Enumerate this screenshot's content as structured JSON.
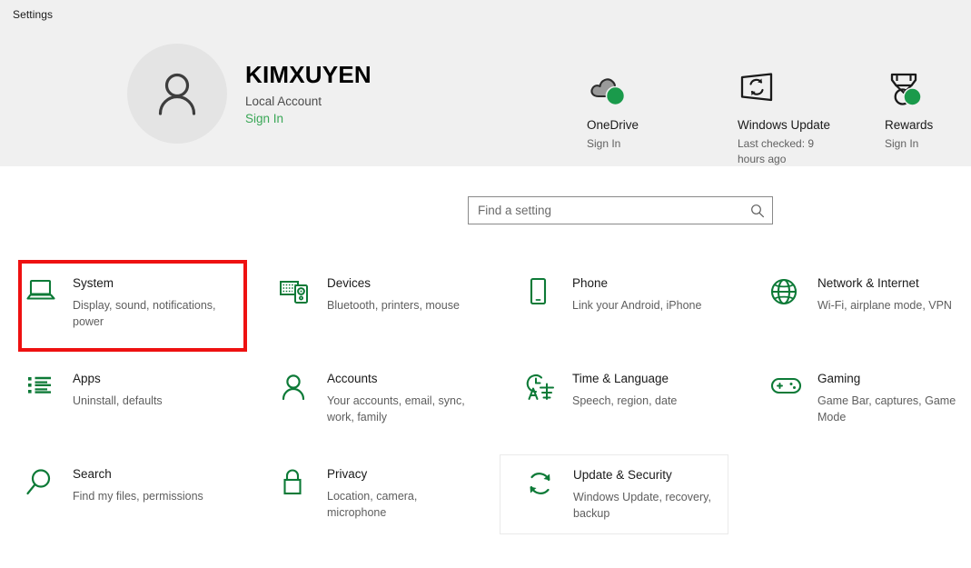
{
  "window": {
    "title": "Settings"
  },
  "account": {
    "name": "KIMXUYEN",
    "type": "Local Account",
    "signin_label": "Sign In",
    "avatar_icon": "person-icon"
  },
  "quick_links": [
    {
      "id": "onedrive",
      "icon": "onedrive-cloud-icon",
      "title": "OneDrive",
      "sub": "Sign In",
      "badge": "online-badge"
    },
    {
      "id": "windows-update",
      "icon": "monitor-sync-icon",
      "title": "Windows Update",
      "sub": "Last checked: 9 hours ago",
      "badge": ""
    },
    {
      "id": "rewards",
      "icon": "medal-icon",
      "title": "Rewards",
      "sub": "Sign In",
      "badge": "online-badge"
    }
  ],
  "search": {
    "placeholder": "Find a setting",
    "value": "",
    "icon": "search-icon"
  },
  "tiles": [
    {
      "id": "system",
      "icon": "laptop-icon",
      "title": "System",
      "sub": "Display, sound, notifications, power"
    },
    {
      "id": "devices",
      "icon": "keyboard-icon",
      "title": "Devices",
      "sub": "Bluetooth, printers, mouse"
    },
    {
      "id": "phone",
      "icon": "phone-icon",
      "title": "Phone",
      "sub": "Link your Android, iPhone"
    },
    {
      "id": "network",
      "icon": "globe-icon",
      "title": "Network & Internet",
      "sub": "Wi-Fi, airplane mode, VPN"
    },
    {
      "id": "apps",
      "icon": "list-icon",
      "title": "Apps",
      "sub": "Uninstall, defaults"
    },
    {
      "id": "accounts",
      "icon": "person-icon",
      "title": "Accounts",
      "sub": "Your accounts, email, sync, work, family"
    },
    {
      "id": "time-language",
      "icon": "clock-language-icon",
      "title": "Time & Language",
      "sub": "Speech, region, date"
    },
    {
      "id": "gaming",
      "icon": "gamepad-icon",
      "title": "Gaming",
      "sub": "Game Bar, captures, Game Mode"
    },
    {
      "id": "search",
      "icon": "magnifier-icon",
      "title": "Search",
      "sub": "Find my files, permissions"
    },
    {
      "id": "privacy",
      "icon": "lock-icon",
      "title": "Privacy",
      "sub": "Location, camera, microphone"
    },
    {
      "id": "update-security",
      "icon": "refresh-icon",
      "title": "Update & Security",
      "sub": "Windows Update, recovery, backup"
    }
  ],
  "annotation": {
    "target": "system",
    "color": "#ee1111"
  },
  "colors": {
    "accent_green": "#0d7a37",
    "link_green": "#3aa757",
    "header_bg": "#f0f0f0",
    "badge_green": "#1a9a4b"
  }
}
